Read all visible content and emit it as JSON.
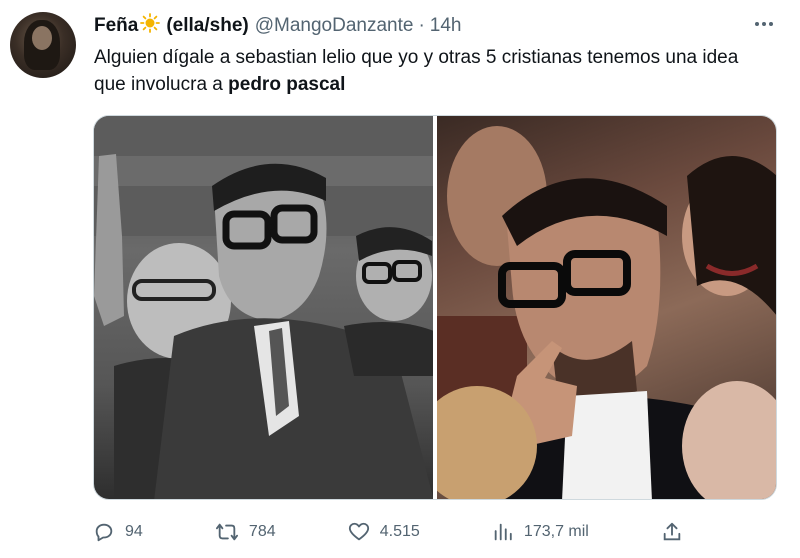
{
  "tweet": {
    "author_name": "Feña",
    "pronouns": "(ella/she)",
    "handle": "@MangoDanzante",
    "separator": "·",
    "time": "14h",
    "text_part1": "Alguien dígale a sebastian lelio que yo y otras 5 cristianas tenemos una idea que involucra a ",
    "text_bold": "pedro pascal"
  },
  "media": {
    "left_photo": "black-and-white photo of a man with glasses waving",
    "right_photo": "color photo of a man with glasses pointing"
  },
  "actions": {
    "replies": "94",
    "retweets": "784",
    "likes": "4.515",
    "views": "173,7 mil"
  },
  "icons": {
    "sun": "sun-emoji-icon",
    "more": "more-options-icon",
    "reply": "reply-icon",
    "retweet": "retweet-icon",
    "like": "heart-icon",
    "views": "views-icon",
    "share": "share-icon"
  },
  "colors": {
    "text": "#0f1419",
    "muted": "#536471",
    "sun": "#f4b400"
  }
}
